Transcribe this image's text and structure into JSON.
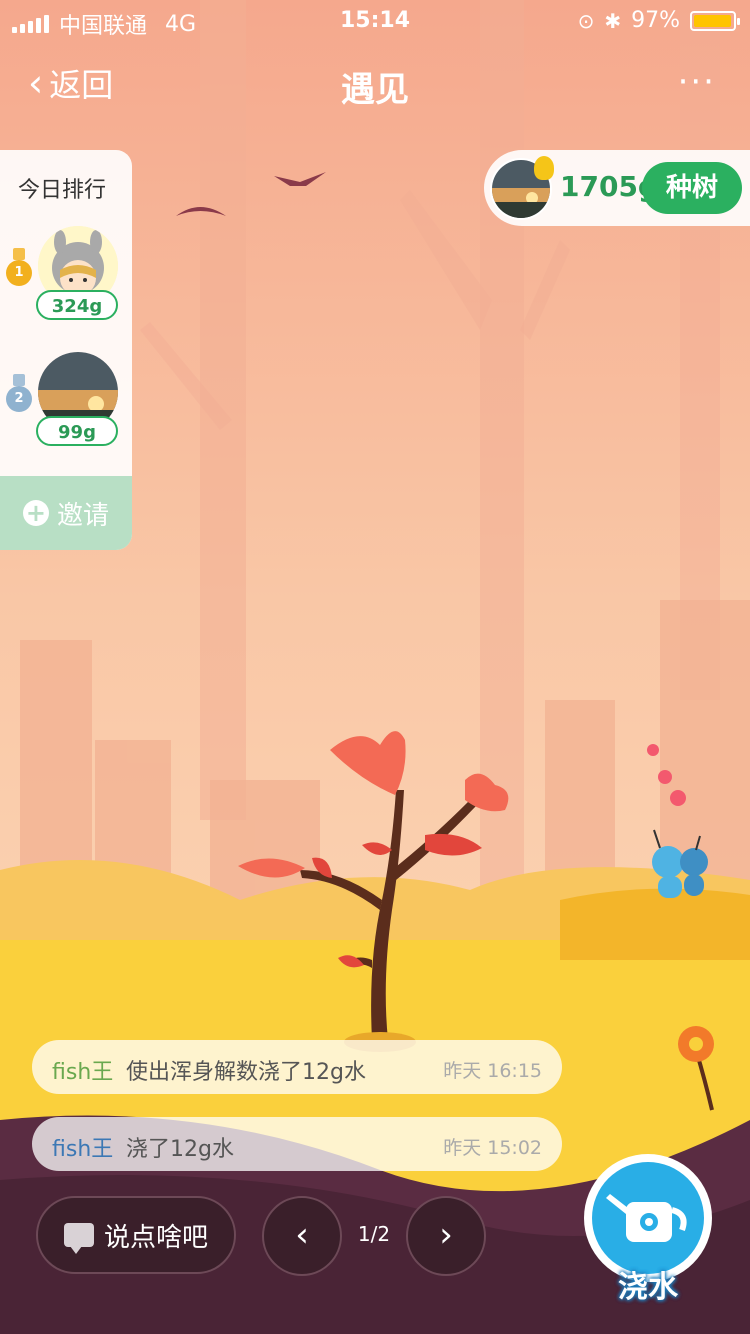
{
  "status_bar": {
    "carrier": "中国联通",
    "network": "4G",
    "time": "15:14",
    "battery": "97%",
    "battery_level": 0.97
  },
  "nav": {
    "back_label": "返回",
    "title": "遇见",
    "more_label": "···"
  },
  "ranking": {
    "title": "今日排行",
    "entries": [
      {
        "rank": "1",
        "score": "324g"
      },
      {
        "rank": "2",
        "score": "99g"
      }
    ],
    "invite_label": "邀请"
  },
  "me": {
    "grams": "1705g",
    "plant_label": "种树"
  },
  "messages": [
    {
      "who": "fish王",
      "text": "使出浑身解数浇了12g水",
      "when": "昨天 16:15"
    },
    {
      "who": "fish王",
      "text": "浇了12g水",
      "when": "昨天 15:02"
    }
  ],
  "controls": {
    "say_label": "说点啥吧",
    "page": "1/2",
    "prev": "‹",
    "next": "›",
    "water_label": "浇水"
  },
  "colors": {
    "green": "#2bb060",
    "water_blue": "#29aee6",
    "sky": "#f6b89a",
    "ground": "#f9c93a",
    "soil": "#4a2436"
  }
}
